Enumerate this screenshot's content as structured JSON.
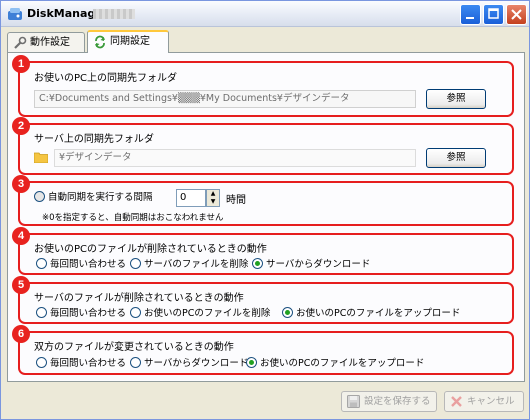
{
  "window": {
    "title": "DiskManager"
  },
  "tabs": [
    {
      "label": "動作設定"
    },
    {
      "label": "同期設定"
    }
  ],
  "sections": {
    "local_folder": {
      "number": "1",
      "label": "お使いのPC上の同期先フォルダ",
      "path_value": "C:¥Documents and Settings¥▒▒▒¥My Documents¥デザインデータ",
      "button": "参照"
    },
    "server_folder": {
      "number": "2",
      "label": "サーバ上の同期先フォルダ",
      "path_value": "¥デザインデータ",
      "button": "参照"
    },
    "auto_sync": {
      "number": "3",
      "label": "自動同期を実行する間隔",
      "value": "0",
      "unit": "時間",
      "note": "※0を指定すると、自動同期はおこなわれません"
    },
    "local_deleted": {
      "number": "4",
      "label": "お使いのPCのファイルが削除されているときの動作",
      "options": [
        "毎回問い合わせる",
        "サーバのファイルを削除",
        "サーバからダウンロード"
      ],
      "selected_index": 2
    },
    "server_deleted": {
      "number": "5",
      "label": "サーバのファイルが削除されているときの動作",
      "options": [
        "毎回問い合わせる",
        "お使いのPCのファイルを削除",
        "お使いのPCのファイルをアップロード"
      ],
      "selected_index": 2
    },
    "both_changed": {
      "number": "6",
      "label": "双方のファイルが変更されているときの動作",
      "options": [
        "毎回問い合わせる",
        "サーバからダウンロード",
        "お使いのPCのファイルをアップロード"
      ],
      "selected_index": 2
    }
  },
  "footer": {
    "save_label": "設定を保存する",
    "cancel_label": "キャンセル"
  },
  "colors": {
    "highlight_border": "#e61e1e",
    "badge": "#e8231f",
    "radio_selected": "#21a121"
  }
}
